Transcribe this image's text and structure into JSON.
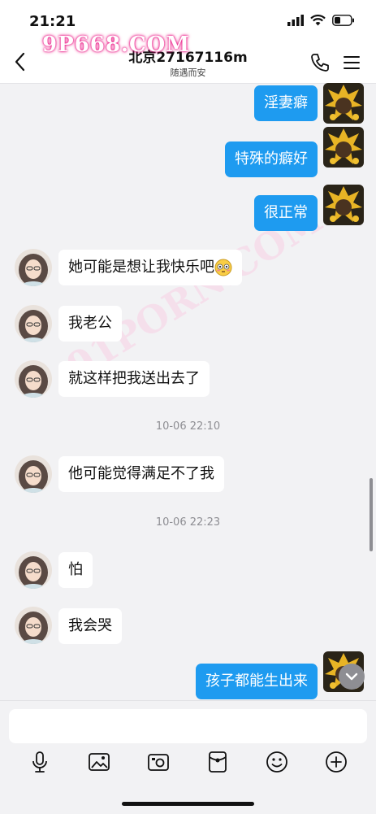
{
  "status": {
    "time": "21:21"
  },
  "header": {
    "title": "北京27167116m",
    "subtitle": "随遇而安"
  },
  "watermarks": {
    "top": "9P668.COM",
    "diagonal": "91PORN.COM"
  },
  "messages": [
    {
      "side": "right",
      "text": "淫妻癖"
    },
    {
      "side": "right",
      "text": "特殊的癖好"
    },
    {
      "side": "right",
      "text": "很正常"
    },
    {
      "side": "left",
      "text": "她可能是想让我快乐吧"
    },
    {
      "side": "left",
      "text": "我老公"
    },
    {
      "side": "left",
      "text": "就这样把我送出去了"
    },
    {
      "side": "time",
      "text": "10-06 22:10"
    },
    {
      "side": "left",
      "text": "他可能觉得满足不了我"
    },
    {
      "side": "time",
      "text": "10-06 22:23"
    },
    {
      "side": "left",
      "text": "怕"
    },
    {
      "side": "left",
      "text": "我会哭"
    },
    {
      "side": "right",
      "text": "孩子都能生出来"
    }
  ],
  "toolbar_icons": [
    "microphone-icon",
    "image-icon",
    "camera-icon",
    "red-packet-icon",
    "emoji-icon",
    "plus-icon"
  ],
  "colors": {
    "bubble_out": "#1e9bf0",
    "bubble_in": "#ffffff",
    "background": "#f2f2f4",
    "watermark": "#e9007a"
  }
}
